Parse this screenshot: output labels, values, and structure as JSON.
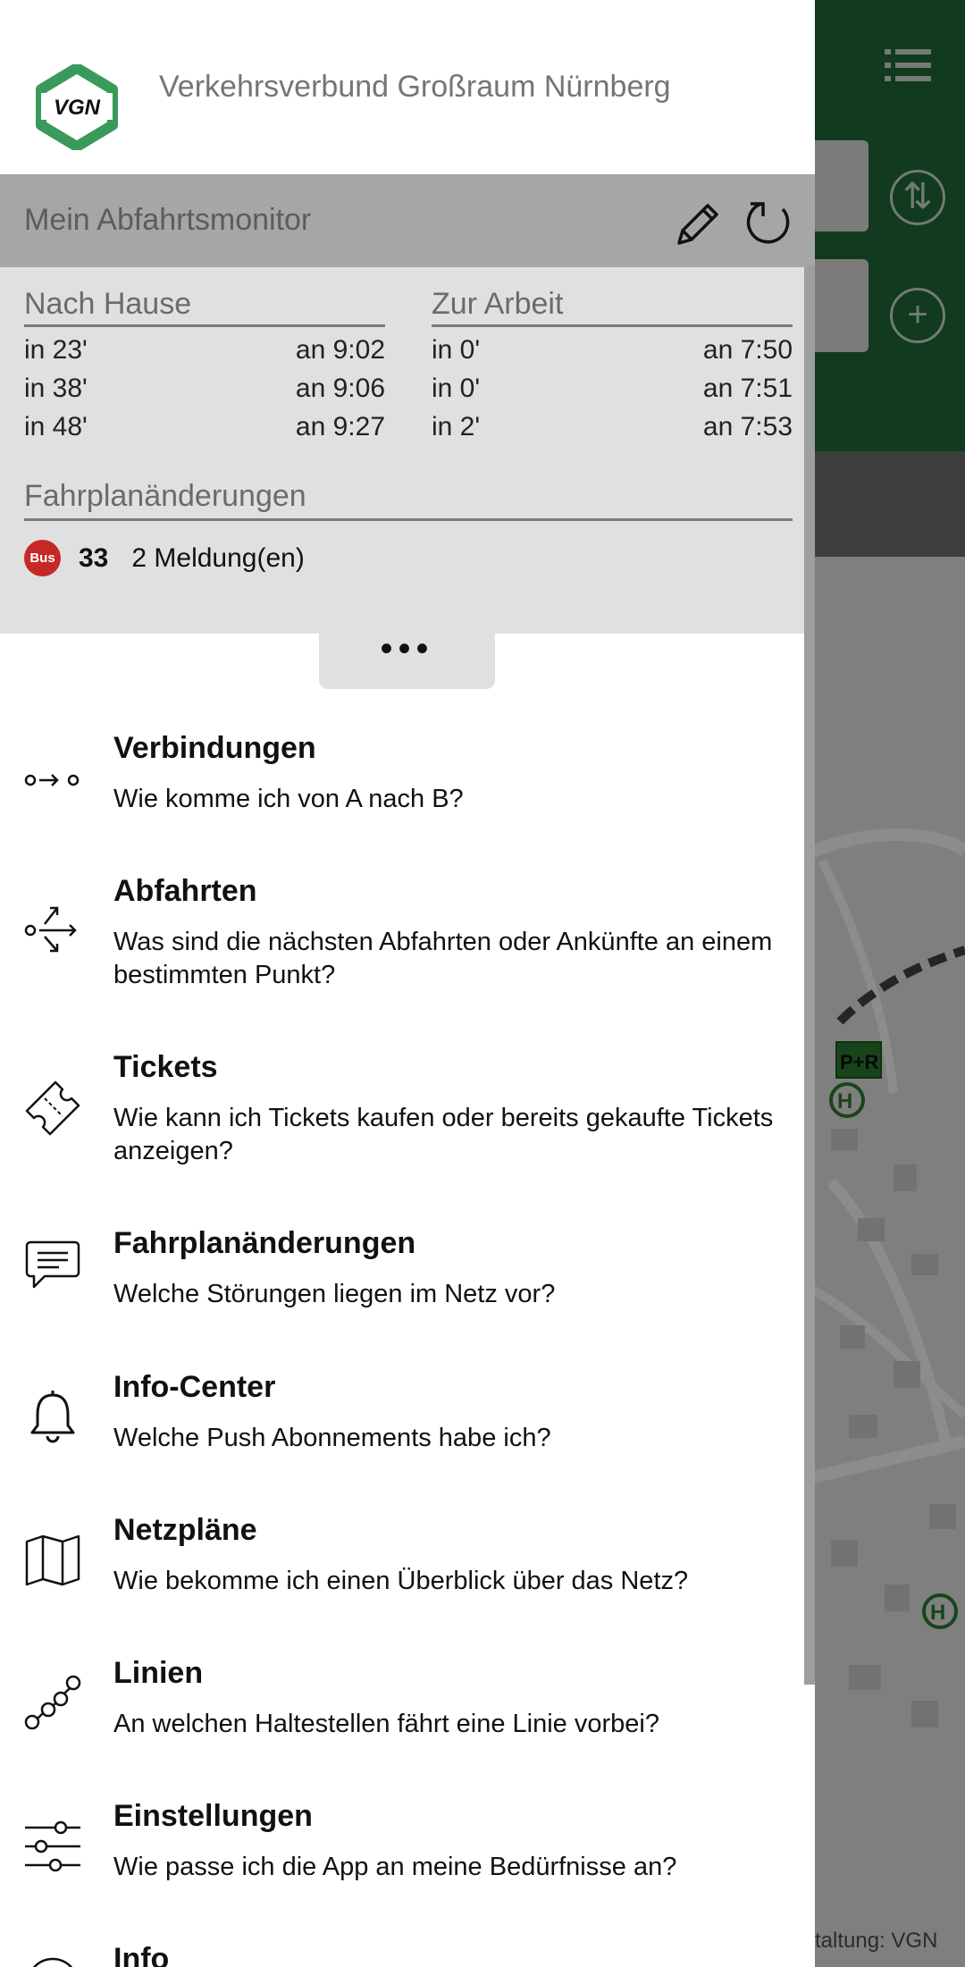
{
  "header": {
    "brand_title": "Verkehrsverbund Großraum Nürnberg",
    "logo_text": "VGN"
  },
  "monitor": {
    "title": "Mein Abfahrtsmonitor",
    "columns": [
      {
        "heading": "Nach Hause",
        "rows": [
          {
            "in": "in 23'",
            "an": "an 9:02"
          },
          {
            "in": "in 38'",
            "an": "an 9:06"
          },
          {
            "in": "in 48'",
            "an": "an 9:27"
          }
        ]
      },
      {
        "heading": "Zur Arbeit",
        "rows": [
          {
            "in": "in 0'",
            "an": "an 7:50"
          },
          {
            "in": "in 0'",
            "an": "an 7:51"
          },
          {
            "in": "in 2'",
            "an": "an 7:53"
          }
        ]
      }
    ],
    "changes_heading": "Fahrplanänderungen",
    "change": {
      "badge": "Bus",
      "line": "33",
      "text": "2 Meldung(en)"
    },
    "more": "•••"
  },
  "menu": [
    {
      "title": "Verbindungen",
      "subtitle": "Wie komme ich von A nach B?",
      "icon": "route-icon"
    },
    {
      "title": "Abfahrten",
      "subtitle": "Was sind die nächsten Abfahrten oder Ankünfte an einem bestimmten Punkt?",
      "icon": "departures-icon"
    },
    {
      "title": "Tickets",
      "subtitle": "Wie kann ich Tickets kaufen oder bereits gekaufte Tickets anzeigen?",
      "icon": "ticket-icon"
    },
    {
      "title": "Fahrplanänderungen",
      "subtitle": "Welche Störungen liegen im Netz vor?",
      "icon": "chat-icon"
    },
    {
      "title": "Info-Center",
      "subtitle": "Welche Push Abonnements habe ich?",
      "icon": "bell-icon"
    },
    {
      "title": "Netzpläne",
      "subtitle": "Wie bekomme ich einen Überblick über das Netz?",
      "icon": "map-icon"
    },
    {
      "title": "Linien",
      "subtitle": "An welchen Haltestellen fährt eine Linie vorbei?",
      "icon": "line-icon"
    },
    {
      "title": "Einstellungen",
      "subtitle": "Wie passe ich die App an meine Bedürfnisse an?",
      "icon": "sliders-icon"
    },
    {
      "title": "Info",
      "subtitle": "",
      "icon": "info-icon"
    }
  ],
  "background": {
    "credit": "staltung: VGN",
    "map_labels": [
      "P+R",
      "H",
      "H"
    ]
  },
  "colors": {
    "brand_green": "#1f6a3a",
    "bus_red": "#c62828"
  }
}
